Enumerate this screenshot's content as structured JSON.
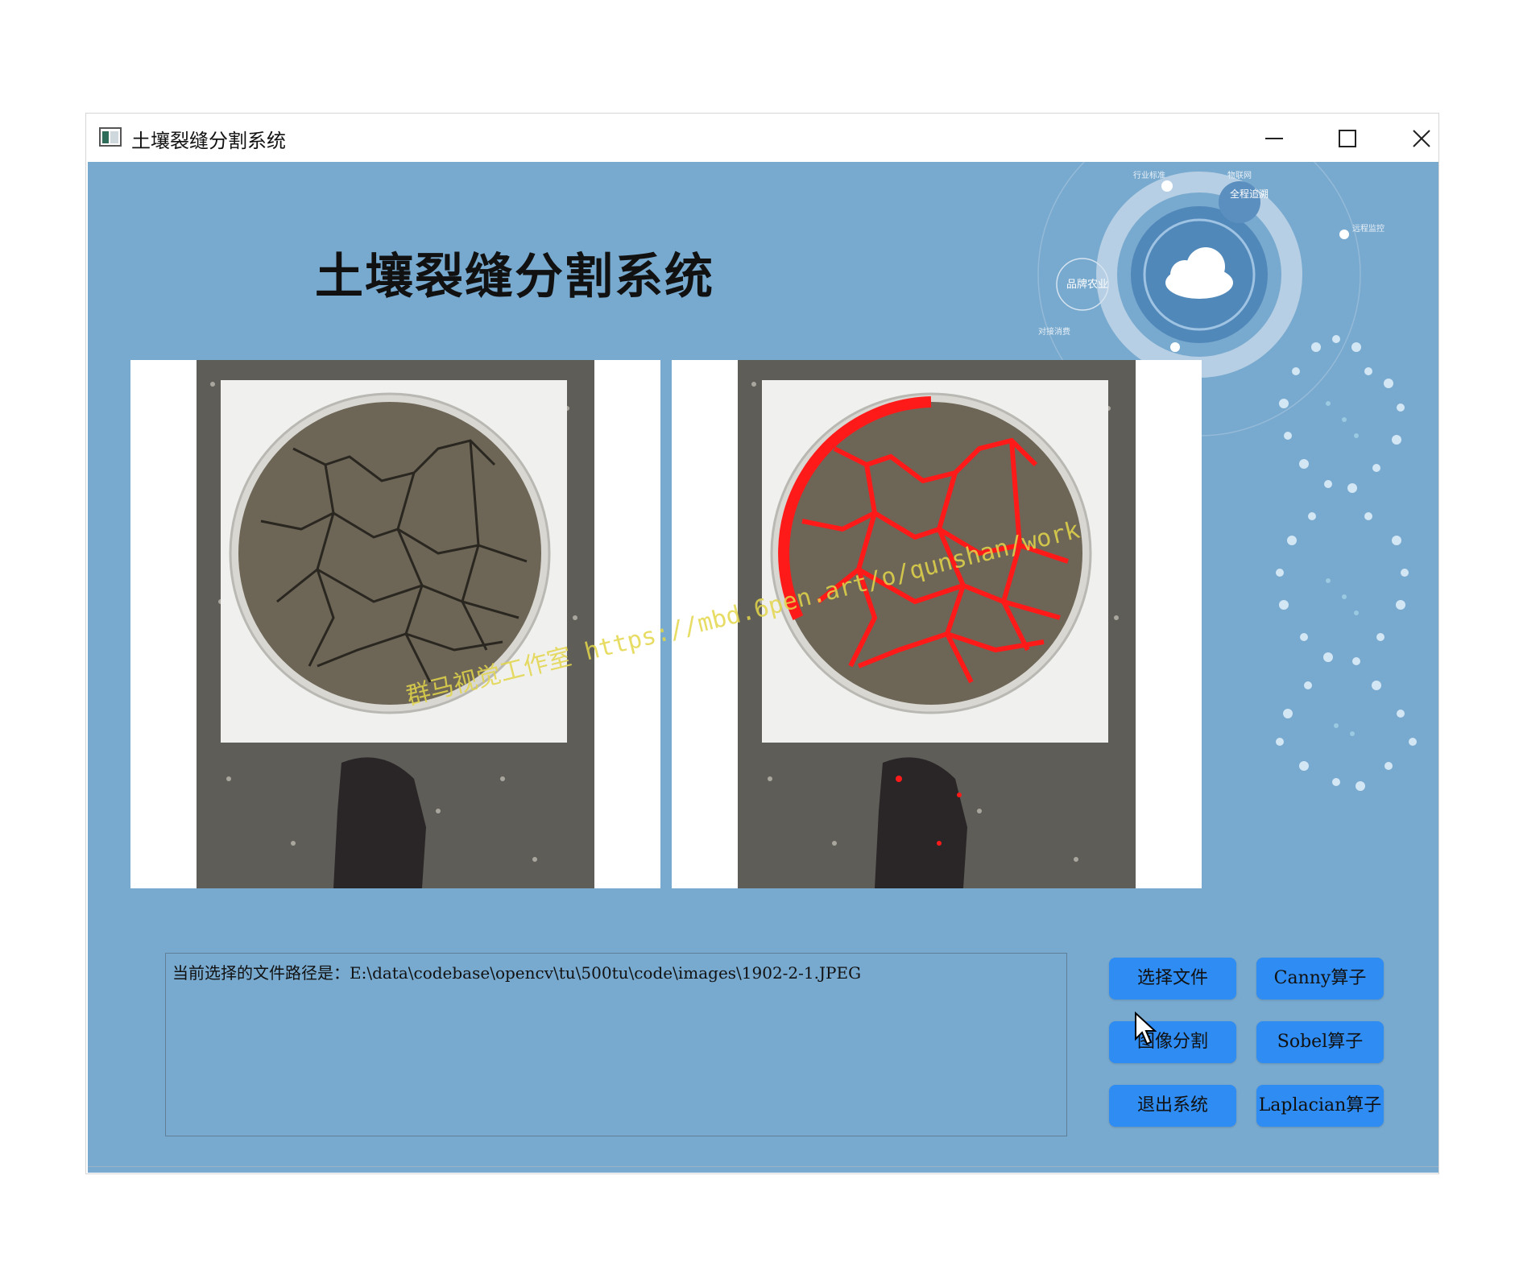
{
  "window": {
    "title": "土壤裂缝分割系统",
    "controls": [
      "minimize",
      "maximize",
      "close"
    ]
  },
  "app": {
    "title": "土壤裂缝分割系统",
    "watermark": "群马视觉工作室 https://mbd.6pen.art/o/qunshan/work"
  },
  "images": {
    "left": "original-soil-image",
    "right": "segmented-crack-overlay"
  },
  "path_box": {
    "text": "当前选择的文件路径是：E:\\data\\codebase\\opencv\\tu\\500tu\\code\\images\\1902-2-1.JPEG"
  },
  "buttons": {
    "select_file": "选择文件",
    "segment": "图像分割",
    "exit": "退出系统",
    "canny": "Canny算子",
    "sobel": "Sobel算子",
    "laplacian": "Laplacian算子"
  },
  "decoration": {
    "labels": [
      "行业标准",
      "物联网",
      "全程追溯",
      "远程监控",
      "品牌农业",
      "对接消费"
    ]
  },
  "colors": {
    "background": "#78a9ce",
    "button": "#2e8cf2",
    "crack_highlight": "#ff1a1a"
  }
}
